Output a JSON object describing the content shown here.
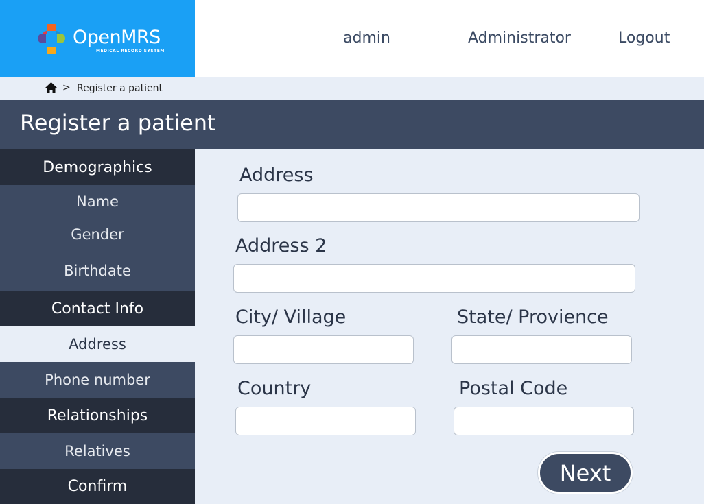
{
  "brand": {
    "name": "OpenMRS",
    "tagline": "MEDICAL RECORD SYSTEM"
  },
  "header": {
    "username": "admin",
    "role": "Administrator",
    "logout": "Logout"
  },
  "breadcrumb": {
    "separator": ">",
    "current": "Register a patient"
  },
  "page": {
    "title": "Register a patient"
  },
  "sidebar": {
    "sections": [
      {
        "label": "Demographics",
        "items": [
          "Name",
          "Gender",
          "Birthdate"
        ]
      },
      {
        "label": "Contact Info",
        "items": [
          "Address",
          "Phone number"
        ]
      },
      {
        "label": "Relationships",
        "items": [
          "Relatives"
        ]
      },
      {
        "label": "Confirm",
        "items": []
      }
    ],
    "active_item": "Address"
  },
  "form": {
    "address": {
      "label": "Address",
      "value": ""
    },
    "address2": {
      "label": "Address 2",
      "value": ""
    },
    "city": {
      "label": "City/ Village",
      "value": ""
    },
    "state": {
      "label": "State/ Provience",
      "value": ""
    },
    "country": {
      "label": "Country",
      "value": ""
    },
    "postal": {
      "label": "Postal Code",
      "value": ""
    },
    "next": "Next"
  },
  "colors": {
    "brand_blue": "#1aa0f5",
    "nav_dark": "#262d3b",
    "nav_mid": "#3d4a62",
    "page_bg": "#e8eef7"
  }
}
